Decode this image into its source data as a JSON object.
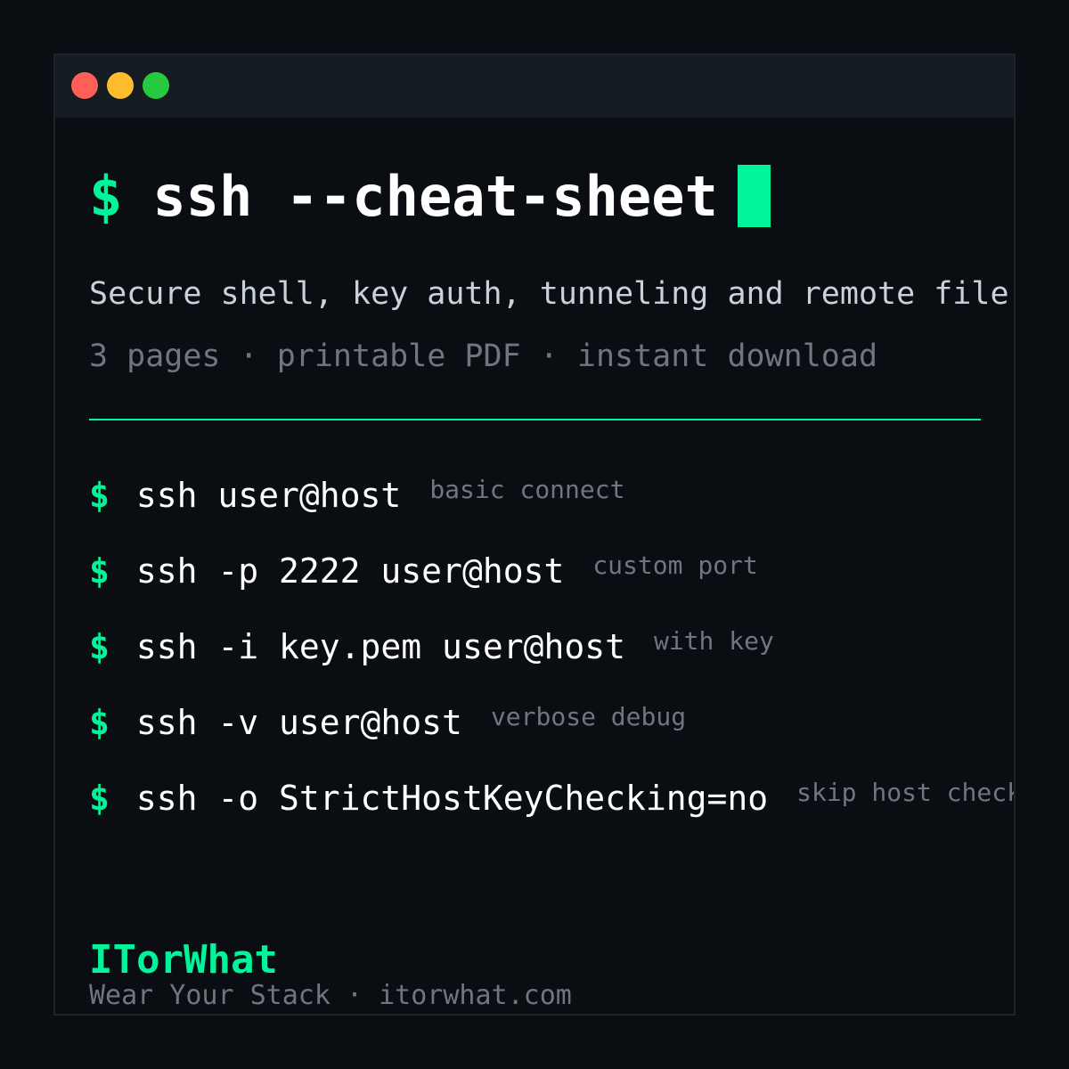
{
  "window": {
    "controls": [
      "close",
      "minimize",
      "maximize"
    ]
  },
  "title": {
    "prompt": "$",
    "text": "ssh --cheat-sheet"
  },
  "subtitle": "Secure shell, key auth, tunneling and remote file",
  "meta": "3 pages · printable PDF · instant download",
  "commands": [
    {
      "prompt": "$",
      "command": "ssh user@host",
      "note": "basic connect"
    },
    {
      "prompt": "$",
      "command": "ssh -p 2222 user@host",
      "note": "custom port"
    },
    {
      "prompt": "$",
      "command": "ssh -i key.pem user@host",
      "note": "with key"
    },
    {
      "prompt": "$",
      "command": "ssh -v user@host",
      "note": "verbose debug"
    },
    {
      "prompt": "$",
      "command": "ssh -o StrictHostKeyChecking=no",
      "note": "skip host check"
    }
  ],
  "footer": {
    "brand": "ITorWhat",
    "tagline": "Wear Your Stack · itorwhat.com"
  },
  "colors": {
    "background": "#0a0d12",
    "titlebar": "#161c23",
    "accent": "#00f59a",
    "text": "#ffffff",
    "muted": "#6e7681",
    "close": "#ff5f56",
    "minimize": "#ffbd2e",
    "maximize": "#27c93f"
  }
}
